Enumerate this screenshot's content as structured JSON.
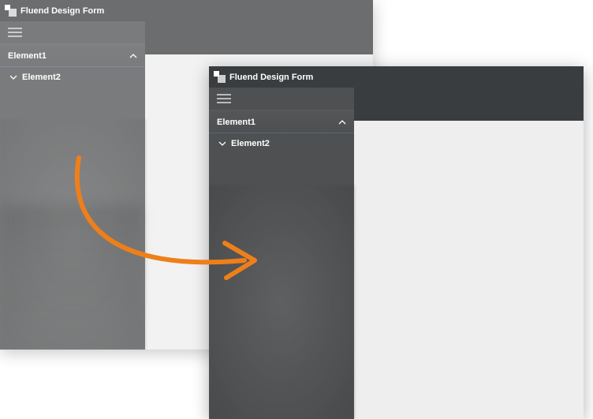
{
  "window_back": {
    "title": "Fluend Design Form",
    "sidebar": {
      "group_header": "Element1",
      "group_item": "Element2"
    }
  },
  "window_front": {
    "title": "Fluend Design Form",
    "sidebar": {
      "group_header": "Element1",
      "group_item": "Element2"
    }
  }
}
